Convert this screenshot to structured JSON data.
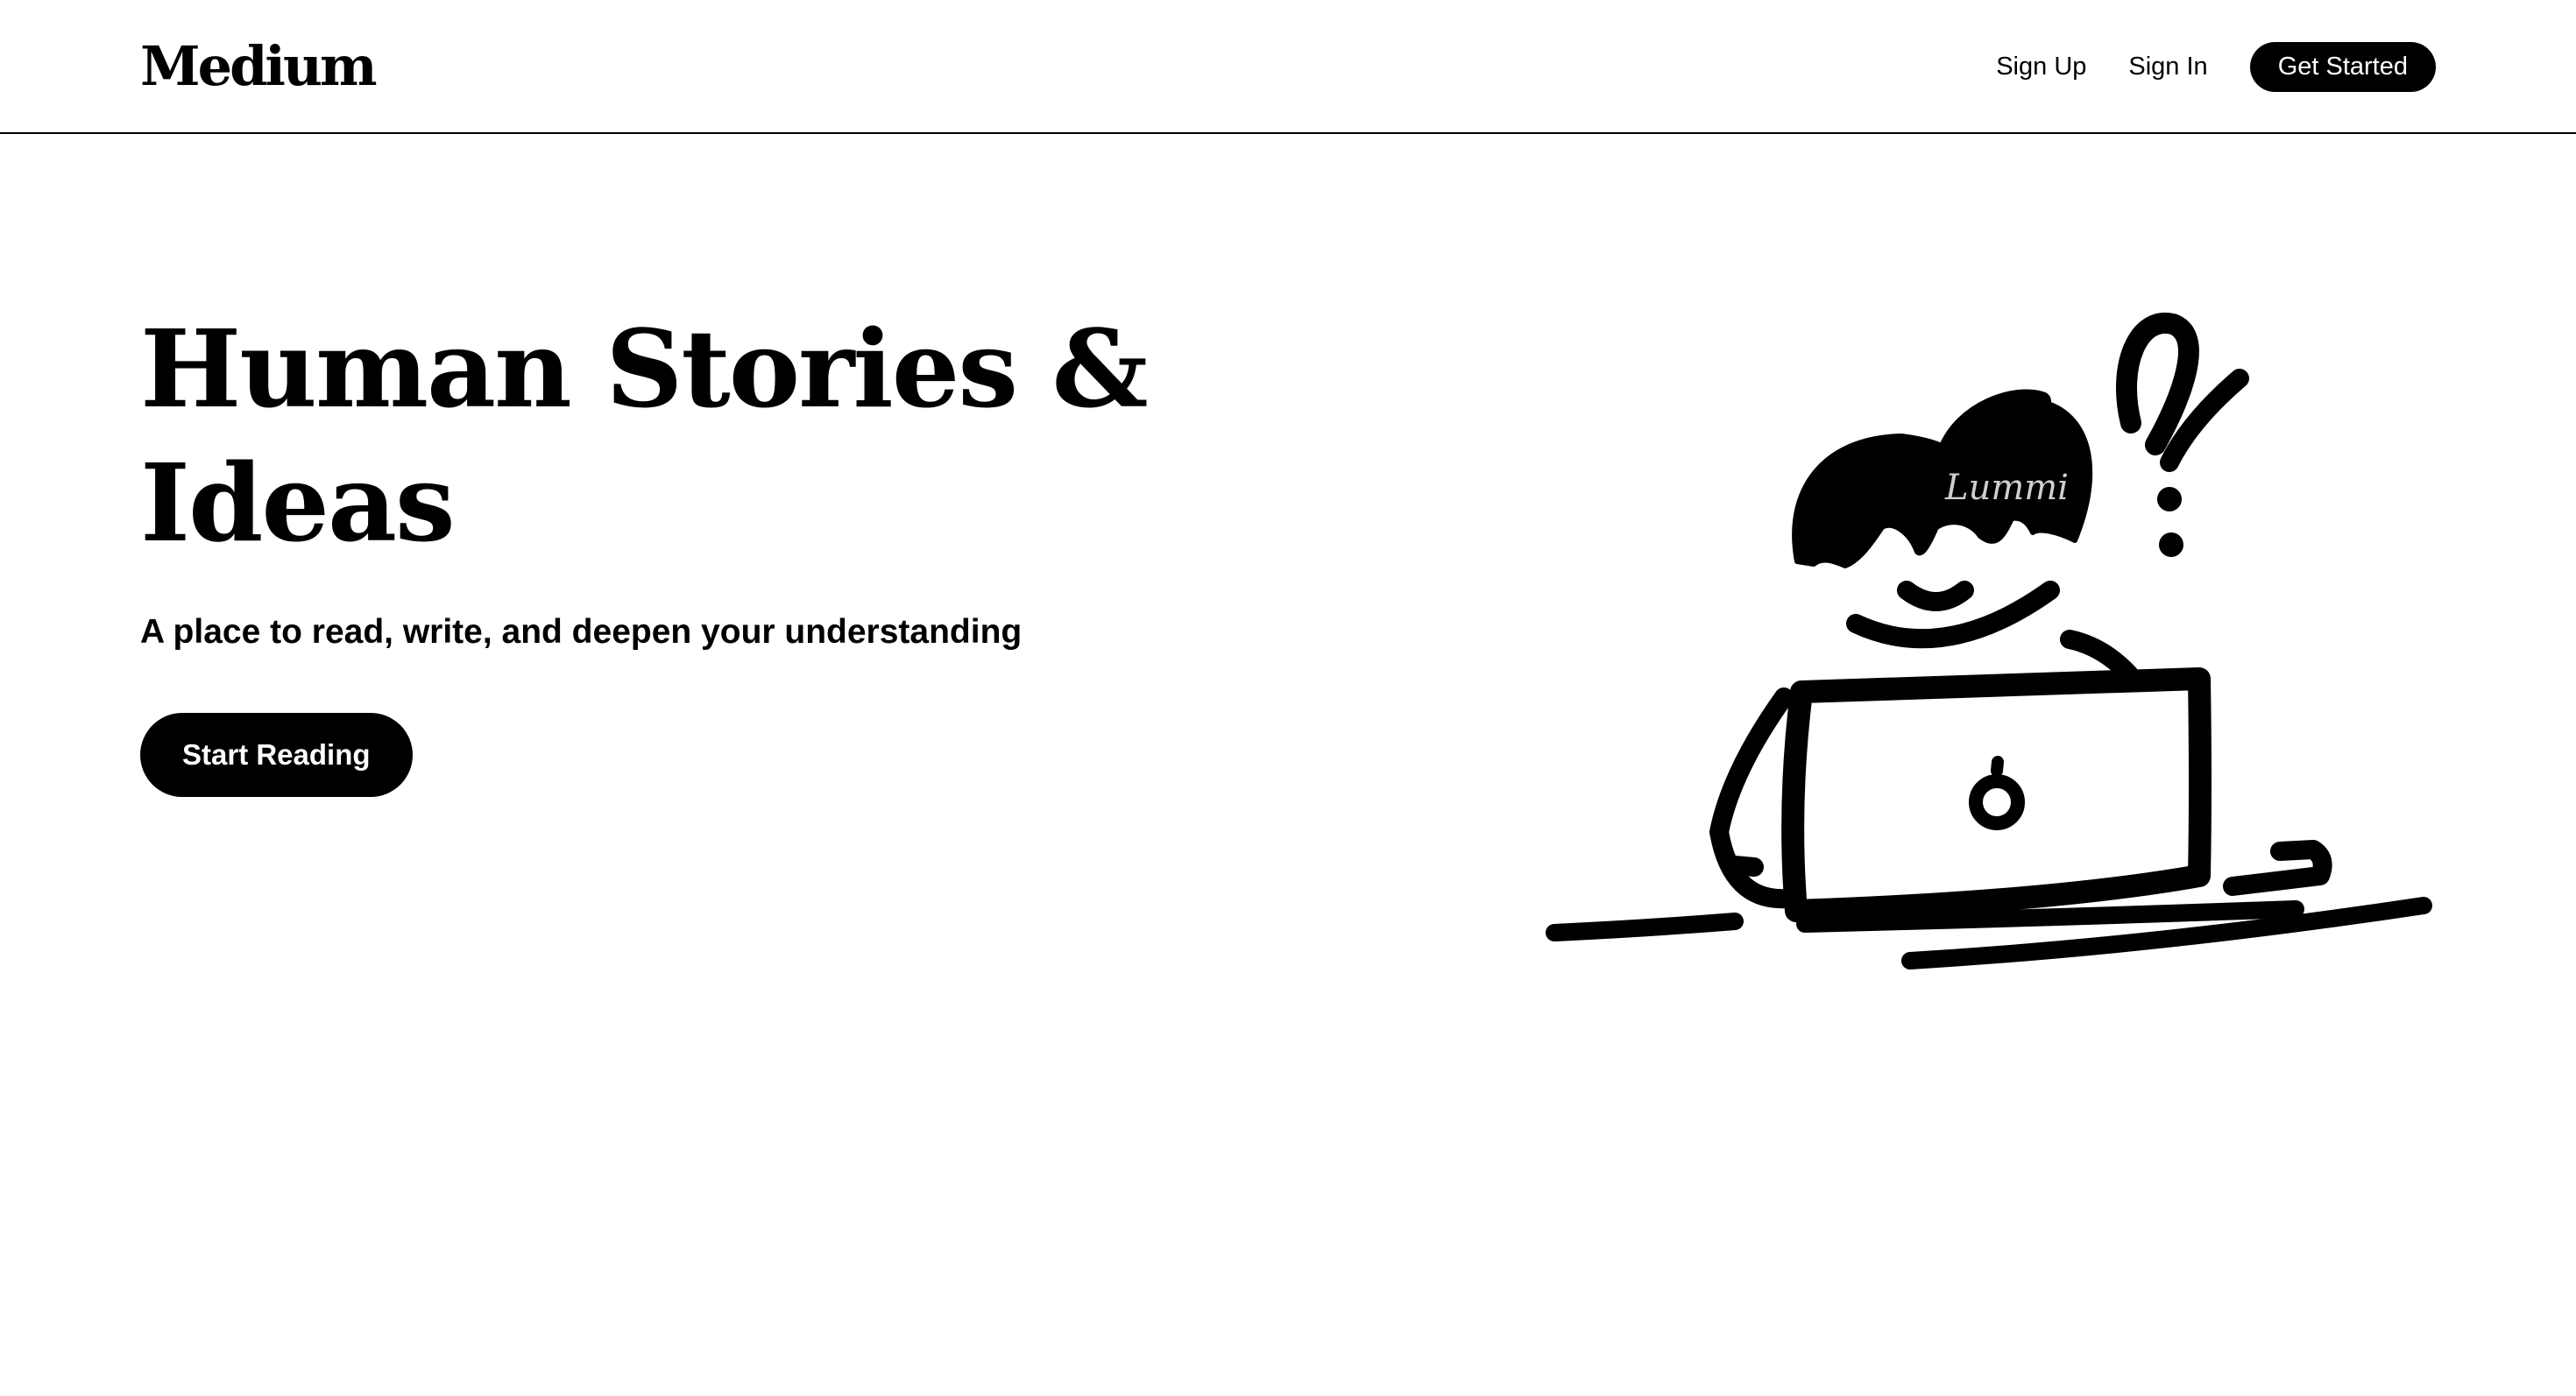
{
  "brand": {
    "name": "Medium"
  },
  "nav": {
    "sign_up": "Sign Up",
    "sign_in": "Sign In",
    "get_started": "Get Started"
  },
  "hero": {
    "title": "Human Stories & Ideas",
    "subtitle": "A place to read, write, and deepen your understanding",
    "cta": "Start Reading"
  },
  "illustration": {
    "icon": "person-at-laptop-illustration",
    "watermark": "Lummi"
  },
  "colors": {
    "background": "#ffffff",
    "text": "#000000",
    "button_bg": "#000000",
    "button_text": "#ffffff"
  }
}
